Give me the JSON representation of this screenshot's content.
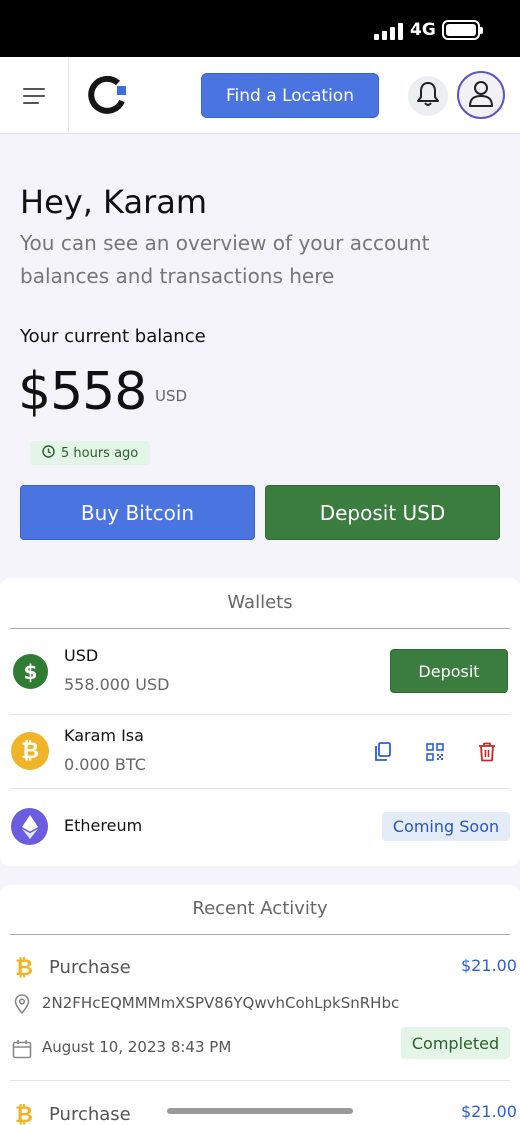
{
  "status_bar": {
    "network": "4G"
  },
  "header": {
    "find_location_label": "Find a Location"
  },
  "greeting": {
    "title": "Hey, Karam",
    "subtitle": "You can see an overview of your account balances and transactions here"
  },
  "balance": {
    "label": "Your current balance",
    "amount": "$558",
    "currency": "USD",
    "updated": "5 hours ago"
  },
  "actions": {
    "buy_label": "Buy Bitcoin",
    "deposit_label": "Deposit USD"
  },
  "wallets": {
    "title": "Wallets",
    "items": [
      {
        "name": "USD",
        "balance": "558.000 USD",
        "action_label": "Deposit",
        "icon": "dollar-icon",
        "color": "#2e7d32"
      },
      {
        "name": "Karam Isa",
        "balance": "0.000 BTC",
        "icon": "bitcoin-icon",
        "color": "#f0b429"
      },
      {
        "name": "Ethereum",
        "badge": "Coming Soon",
        "icon": "ethereum-icon",
        "color": "#6b5ce0"
      }
    ]
  },
  "activity": {
    "title": "Recent Activity",
    "items": [
      {
        "type": "Purchase",
        "amount": "$21.00",
        "address": "2N2FHcEQMMMmXSPV86YQwvhCohLpkSnRHbc",
        "date": "August 10, 2023 8:43 PM",
        "status": "Completed"
      },
      {
        "type": "Purchase",
        "amount": "$21.00"
      }
    ]
  },
  "colors": {
    "primary": "#4a74e0",
    "success": "#3a7d3f",
    "link": "#2b5fd8",
    "danger": "#c62828"
  }
}
